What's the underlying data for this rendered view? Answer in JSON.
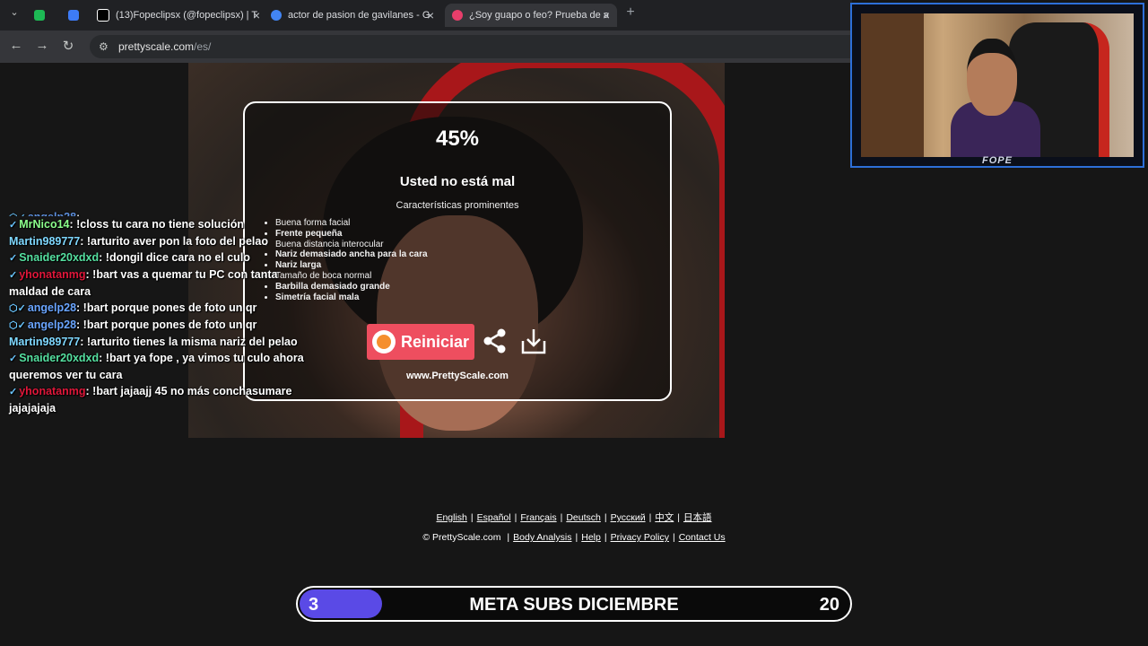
{
  "browser": {
    "tabs": [
      {
        "title": "",
        "color": "#1db954"
      },
      {
        "title": "",
        "color": "#3d7bf7"
      },
      {
        "title": "(13)Fopeclipsx (@fopeclipsx) | T",
        "color": "#000000"
      },
      {
        "title": "actor de pasion de gavilanes - G",
        "color": "#4285f4"
      },
      {
        "title": "¿Soy guapo o feo? Prueba de a",
        "color": "#e83e6b"
      }
    ],
    "url_host": "prettyscale.com",
    "url_path": "/es/"
  },
  "webcam": {
    "label": "FOPE"
  },
  "card": {
    "percent": "45%",
    "verdict": "Usted no está mal",
    "subtitle": "Características prominentes",
    "traits": [
      {
        "text": "Buena forma facial",
        "bold": false
      },
      {
        "text": "Frente pequeña",
        "bold": true
      },
      {
        "text": "Buena distancia interocular",
        "bold": false
      },
      {
        "text": "Nariz demasiado ancha para la cara",
        "bold": true
      },
      {
        "text": "Nariz larga",
        "bold": true
      },
      {
        "text": "Tamaño de boca normal",
        "bold": false
      },
      {
        "text": "Barbilla demasiado grande",
        "bold": true
      },
      {
        "text": "Simetría facial mala",
        "bold": true
      }
    ],
    "restart_label": "Reiniciar",
    "site": "www.PrettyScale.com"
  },
  "chat": [
    {
      "badge": "⬡✓",
      "user": "angelp28",
      "color": "blue",
      "msg": ": "
    },
    {
      "badge": "✓",
      "user": "MrNico14",
      "color": "lime",
      "msg": ": !closs tu cara no tiene solución"
    },
    {
      "badge": "",
      "user": "Martin989777",
      "color": "cyan",
      "msg": ": !arturito aver pon la foto del pelao"
    },
    {
      "badge": "✓",
      "user": "Snaider20xdxd",
      "color": "green",
      "msg": ": !dongil dice cara no el culo"
    },
    {
      "badge": "✓",
      "user": "yhonatanmg",
      "color": "red",
      "msg": ": !bart vas a quemar tu PC con tanta maldad de cara"
    },
    {
      "badge": "⬡✓",
      "user": "angelp28",
      "color": "blue",
      "msg": ": !bart porque pones de foto un qr"
    },
    {
      "badge": "⬡✓",
      "user": "angelp28",
      "color": "blue",
      "msg": ": !bart porque pones de foto un qr"
    },
    {
      "badge": "",
      "user": "Martin989777",
      "color": "cyan",
      "msg": ": !arturito tienes la misma nariz del pelao"
    },
    {
      "badge": "✓",
      "user": "Snaider20xdxd",
      "color": "green",
      "msg": ": !bart ya fope , ya vimos tu culo ahora queremos ver tu cara"
    },
    {
      "badge": "✓",
      "user": "yhonatanmg",
      "color": "red",
      "msg": ": !bart jajaajj 45 no más conchasumare jajajajaja"
    }
  ],
  "languages": [
    "English",
    "Español",
    "Français",
    "Deutsch",
    "Русский",
    "中文",
    "日本語"
  ],
  "footer": {
    "copyright": "© PrettyScale.com",
    "links": [
      "Body Analysis",
      "Help",
      "Privacy Policy",
      "Contact Us"
    ]
  },
  "goal": {
    "current": "3",
    "title": "META SUBS DICIEMBRE",
    "target": "20",
    "progress_fraction": 0.15,
    "fill_color": "#5a4ae6"
  }
}
